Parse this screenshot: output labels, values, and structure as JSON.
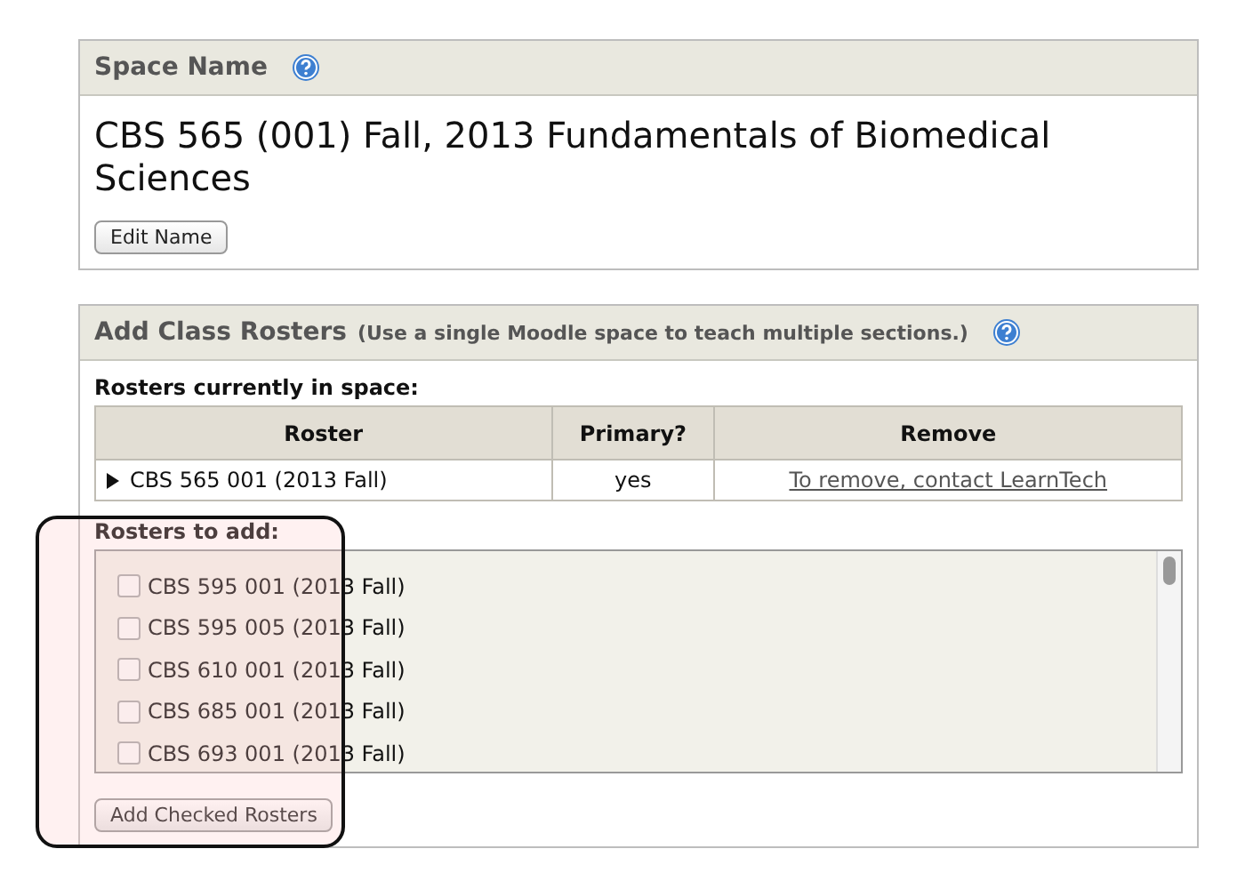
{
  "space_name": {
    "heading": "Space Name",
    "title": "CBS 565 (001) Fall, 2013 Fundamentals of Biomedical Sciences",
    "button": "Edit Name"
  },
  "class_rosters": {
    "heading": "Add Class Rosters",
    "note": "(Use a single Moodle space to teach multiple sections.)",
    "current_label": "Rosters currently in space:",
    "table": {
      "columns": [
        "Roster",
        "Primary?",
        "Remove"
      ],
      "rows": [
        {
          "roster": "CBS 565 001 (2013 Fall)",
          "expanded": false,
          "primary": "yes",
          "remove": "To remove, contact LearnTech"
        }
      ]
    },
    "to_add_label": "Rosters to add:",
    "to_add": [
      {
        "label": "CBS 595 001 (2013 Fall)",
        "checked": false
      },
      {
        "label": "CBS 595 005 (2013 Fall)",
        "checked": false
      },
      {
        "label": "CBS 610 001 (2013 Fall)",
        "checked": false
      },
      {
        "label": "CBS 685 001 (2013 Fall)",
        "checked": false
      },
      {
        "label": "CBS 693 001 (2013 Fall)",
        "checked": false
      }
    ],
    "button": "Add Checked Rosters"
  }
}
